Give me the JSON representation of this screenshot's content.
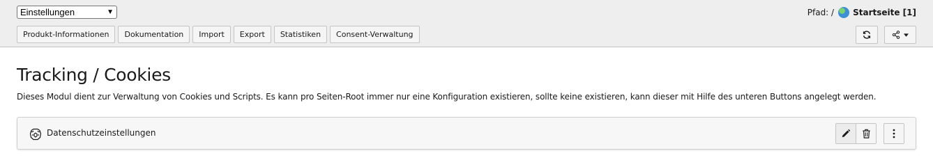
{
  "header": {
    "module_select": "Einstellungen",
    "path_label": "Pfad: /",
    "page_title": "Startseite [1]",
    "buttons": [
      "Produkt-Informationen",
      "Dokumentation",
      "Import",
      "Export",
      "Statistiken",
      "Consent-Verwaltung"
    ],
    "icons": {
      "refresh": "refresh-icon",
      "share": "share-icon"
    }
  },
  "main": {
    "heading": "Tracking / Cookies",
    "description": "Dieses Modul dient zur Verwaltung von Cookies und Scripts. Es kann pro Seiten-Root immer nur eine Konfiguration existieren, sollte keine existieren, kann dieser mit Hilfe des unteren Buttons angelegt werden.",
    "card": {
      "title": "Datenschutzeinstellungen",
      "icons": [
        "cookie-icon",
        "pencil-icon",
        "trash-icon",
        "ellipsis-vertical-icon"
      ]
    }
  },
  "colors": {
    "header_bg": "#eeeeee",
    "card_bg": "#f7f7f7",
    "button_bg": "#f5f5f5",
    "border": "#c4c4c4"
  }
}
